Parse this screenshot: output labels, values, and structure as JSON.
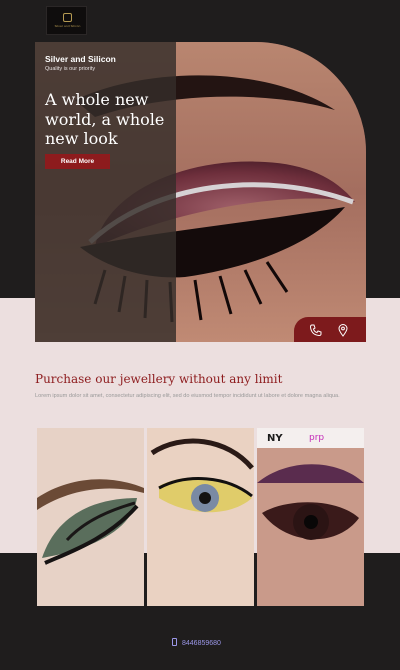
{
  "logo": {
    "name": "Silver and Silicon"
  },
  "hero": {
    "brand": "Silver and Silicon",
    "tagline": "Quality is our priority",
    "headline": "A whole new world, a whole new look",
    "cta": "Read More",
    "contact_icons": [
      "phone-icon",
      "location-pin-icon"
    ]
  },
  "section": {
    "title": "Purchase our jewellery without any limit",
    "body": "Lorem ipsum dolor sit amet, consectetur adipiscing elit, sed do eiusmod tempor incididunt ut labore et dolore magna aliqua.",
    "gallery": [
      "eye-makeup-green",
      "eye-makeup-yellow",
      "eye-makeup-lashes"
    ]
  },
  "footer": {
    "phone": "8446859680",
    "icon": "mobile-icon"
  },
  "colors": {
    "background": "#1f1d1d",
    "band": "#ecdfdf",
    "accent": "#8d1b1d",
    "footer_link": "#9b97e8"
  }
}
